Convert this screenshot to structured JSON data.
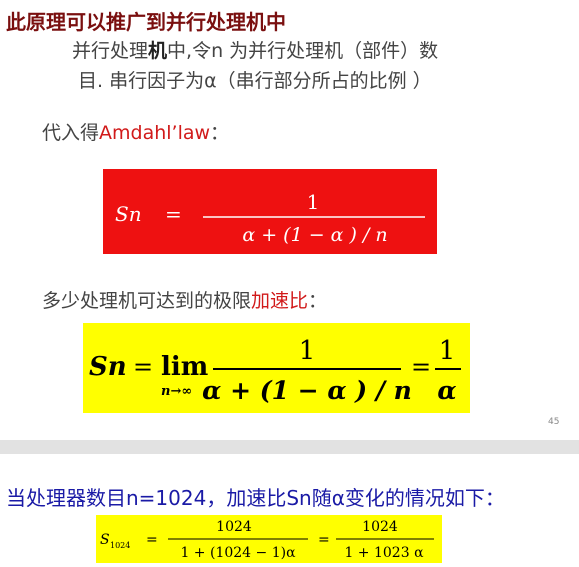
{
  "heading": "此原理可以推广到并行处理机中",
  "p1": {
    "pre": "并行处理",
    "bold": "机",
    "post": "中,令n 为并行处理机（部件）数"
  },
  "p2": "目. 串行因子为α（串行部分所占的比例 ）",
  "intro1": {
    "pre": "代入得",
    "highlight": "Amdahl’law",
    "post": "："
  },
  "formula1": {
    "lhs": "Sn",
    "eq": "=",
    "numerator": "1",
    "denominator": "α + (1 − α ) / n"
  },
  "intro2": {
    "pre": "多少处理机可达到的极限",
    "highlight": "加速比",
    "post": "："
  },
  "formula2": {
    "lhs": "Sn",
    "eq1": "=",
    "lim": "lim",
    "lim_sub": "n→∞",
    "numerator": "1",
    "denominator": "α + (1 − α ) / n",
    "eq2": "=",
    "rhs_num": "1",
    "rhs_den": "α"
  },
  "page_number": "45",
  "bottom_text": "当处理器数目n=1024，加速比Sn随α变化的情况如下：",
  "formula3": {
    "lhs": "S",
    "lhs_sub": "1024",
    "eq1": "=",
    "num1": "1024",
    "den1": "1 + (1024   − 1)α",
    "eq2": "=",
    "num2": "1024",
    "den2": "1 + 1023  α"
  },
  "colors": {
    "heading": "#7a0f0f",
    "red_box": "#ee1111",
    "yellow_box": "#ffff00",
    "bottom_text": "#1a1aa6",
    "highlight": "#d11a1a"
  }
}
